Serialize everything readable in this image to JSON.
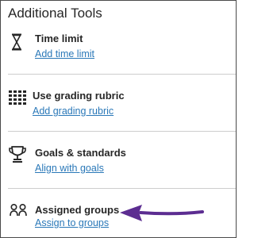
{
  "panel": {
    "title": "Additional Tools"
  },
  "tools": [
    {
      "icon": "hourglass-icon",
      "title": "Time limit",
      "link": "Add time limit"
    },
    {
      "icon": "grading-rubric-icon",
      "title": "Use grading rubric",
      "link": "Add grading rubric"
    },
    {
      "icon": "trophy-icon",
      "title": "Goals & standards",
      "link": "Align with goals"
    },
    {
      "icon": "group-icon",
      "title": "Assigned groups",
      "link": "Assign to groups"
    }
  ],
  "colors": {
    "link": "#2a78b8",
    "text": "#262626",
    "arrow": "#5c2d91",
    "divider": "#cdcdcd"
  }
}
